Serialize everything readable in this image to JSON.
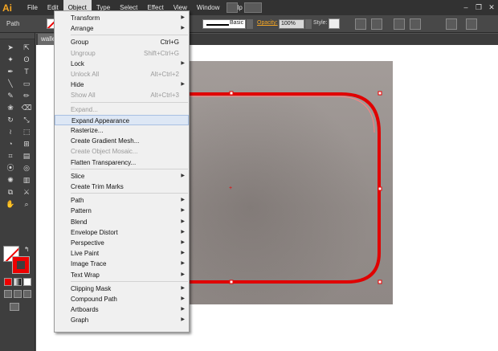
{
  "app": {
    "logo": "Ai"
  },
  "menubar": {
    "items": [
      "File",
      "Edit",
      "Object",
      "Type",
      "Select",
      "Effect",
      "View",
      "Window",
      "Help"
    ],
    "active": "Object"
  },
  "window_controls": {
    "minimize": "–",
    "restore": "❐",
    "close": "✕"
  },
  "control_bar": {
    "selection_label": "Path",
    "stroke_profile": "Basic",
    "opacity_label": "Opacity:",
    "opacity_value": "100%",
    "style_label": "Style:"
  },
  "document_tab": {
    "label": "walle"
  },
  "object_menu": [
    {
      "label": "Transform",
      "shortcut": "",
      "submenu": true,
      "disabled": false
    },
    {
      "label": "Arrange",
      "shortcut": "",
      "submenu": true,
      "disabled": false
    },
    {
      "sep": true
    },
    {
      "label": "Group",
      "shortcut": "Ctrl+G",
      "submenu": false,
      "disabled": false
    },
    {
      "label": "Ungroup",
      "shortcut": "Shift+Ctrl+G",
      "submenu": false,
      "disabled": true
    },
    {
      "label": "Lock",
      "shortcut": "",
      "submenu": true,
      "disabled": false
    },
    {
      "label": "Unlock All",
      "shortcut": "Alt+Ctrl+2",
      "submenu": false,
      "disabled": true
    },
    {
      "label": "Hide",
      "shortcut": "",
      "submenu": true,
      "disabled": false
    },
    {
      "label": "Show All",
      "shortcut": "Alt+Ctrl+3",
      "submenu": false,
      "disabled": true
    },
    {
      "sep": true
    },
    {
      "label": "Expand...",
      "shortcut": "",
      "submenu": false,
      "disabled": true
    },
    {
      "label": "Expand Appearance",
      "shortcut": "",
      "submenu": false,
      "disabled": false,
      "highlighted": true
    },
    {
      "label": "Rasterize...",
      "shortcut": "",
      "submenu": false,
      "disabled": false
    },
    {
      "label": "Create Gradient Mesh...",
      "shortcut": "",
      "submenu": false,
      "disabled": false
    },
    {
      "label": "Create Object Mosaic...",
      "shortcut": "",
      "submenu": false,
      "disabled": true
    },
    {
      "label": "Flatten Transparency...",
      "shortcut": "",
      "submenu": false,
      "disabled": false
    },
    {
      "sep": true
    },
    {
      "label": "Slice",
      "shortcut": "",
      "submenu": true,
      "disabled": false
    },
    {
      "label": "Create Trim Marks",
      "shortcut": "",
      "submenu": false,
      "disabled": false
    },
    {
      "sep": true
    },
    {
      "label": "Path",
      "shortcut": "",
      "submenu": true,
      "disabled": false
    },
    {
      "label": "Pattern",
      "shortcut": "",
      "submenu": true,
      "disabled": false
    },
    {
      "label": "Blend",
      "shortcut": "",
      "submenu": true,
      "disabled": false
    },
    {
      "label": "Envelope Distort",
      "shortcut": "",
      "submenu": true,
      "disabled": false
    },
    {
      "label": "Perspective",
      "shortcut": "",
      "submenu": true,
      "disabled": false
    },
    {
      "label": "Live Paint",
      "shortcut": "",
      "submenu": true,
      "disabled": false
    },
    {
      "label": "Image Trace",
      "shortcut": "",
      "submenu": true,
      "disabled": false
    },
    {
      "label": "Text Wrap",
      "shortcut": "",
      "submenu": true,
      "disabled": false
    },
    {
      "sep": true
    },
    {
      "label": "Clipping Mask",
      "shortcut": "",
      "submenu": true,
      "disabled": false
    },
    {
      "label": "Compound Path",
      "shortcut": "",
      "submenu": true,
      "disabled": false
    },
    {
      "label": "Artboards",
      "shortcut": "",
      "submenu": true,
      "disabled": false
    },
    {
      "label": "Graph",
      "shortcut": "",
      "submenu": true,
      "disabled": false
    }
  ],
  "tools": [
    "selection-tool",
    "direct-selection-tool",
    "magic-wand-tool",
    "lasso-tool",
    "pen-tool",
    "type-tool",
    "line-segment-tool",
    "rectangle-tool",
    "paintbrush-tool",
    "pencil-tool",
    "blob-brush-tool",
    "eraser-tool",
    "rotate-tool",
    "scale-tool",
    "width-tool",
    "free-transform-tool",
    "shape-builder-tool",
    "perspective-grid-tool",
    "mesh-tool",
    "gradient-tool",
    "eyedropper-tool",
    "blend-tool",
    "symbol-sprayer-tool",
    "column-graph-tool",
    "artboard-tool",
    "slice-tool",
    "hand-tool",
    "zoom-tool"
  ],
  "tool_glyphs": [
    "➤",
    "⇱",
    "✦",
    "ʘ",
    "✒",
    "T",
    "╲",
    "▭",
    "✎",
    "✏",
    "❀",
    "⌫",
    "↻",
    "⤡",
    "≀",
    "⬚",
    "◔",
    "⊞",
    "⌗",
    "▤",
    "⦿",
    "◎",
    "✺",
    "▥",
    "⧉",
    "⚔",
    "✋",
    "⌕"
  ],
  "colors": {
    "accent": "#f5a623",
    "selection_red": "#e00000",
    "highlight": "#dde7f5"
  }
}
